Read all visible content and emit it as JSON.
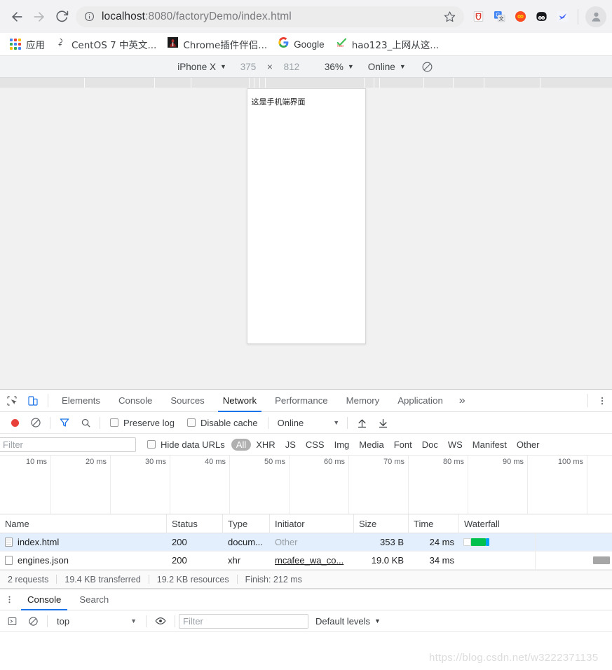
{
  "browser": {
    "nav": {
      "back": "back-arrow",
      "forward": "forward-arrow",
      "reload": "reload"
    },
    "omnibox": {
      "info_icon": "info-circle-icon",
      "url_host": "localhost",
      "url_rest": ":8080/factoryDemo/index.html",
      "star_icon": "bookmark-star-icon"
    },
    "extensions": [
      {
        "name": "maxthon-shield-extension",
        "glyph": "shield"
      },
      {
        "name": "google-translate-extension",
        "glyph": "translate"
      },
      {
        "name": "infinity-newtab-extension",
        "glyph": "infinity"
      },
      {
        "name": "panda-extension",
        "glyph": "panda"
      },
      {
        "name": "blue-bird-extension",
        "glyph": "bird"
      }
    ],
    "profile": "profile-avatar"
  },
  "bookmarks": {
    "apps_label": "应用",
    "items": [
      {
        "label": "CentOS 7 中英文...",
        "icon": "centos-icon"
      },
      {
        "label": "Chrome插件伴侣...",
        "icon": "chrome-companion-icon"
      },
      {
        "label": "Google",
        "icon": "google-icon"
      },
      {
        "label": "hao123_上网从这...",
        "icon": "hao123-icon"
      }
    ]
  },
  "device_toolbar": {
    "device": "iPhone X",
    "width": "375",
    "times": "×",
    "height": "812",
    "zoom": "36%",
    "throttle": "Online",
    "rotate_icon": "rotate-device-icon"
  },
  "viewport": {
    "page_text": "这是手机端界面"
  },
  "devtools": {
    "inspect_icon": "inspect-element-icon",
    "device_toggle_icon": "toggle-device-toolbar-icon",
    "tabs": [
      {
        "label": "Elements",
        "active": false
      },
      {
        "label": "Console",
        "active": false
      },
      {
        "label": "Sources",
        "active": false
      },
      {
        "label": "Network",
        "active": true
      },
      {
        "label": "Performance",
        "active": false
      },
      {
        "label": "Memory",
        "active": false
      },
      {
        "label": "Application",
        "active": false
      }
    ],
    "more_tabs": "»",
    "menu_icon": "kebab-menu-icon"
  },
  "network_toolbar": {
    "record_icon": "record-button",
    "clear_icon": "clear-button",
    "filter_icon": "filter-funnel-icon",
    "search_icon": "search-icon",
    "preserve_log": "Preserve log",
    "disable_cache": "Disable cache",
    "throttle_value": "Online",
    "import_icon": "import-har-icon",
    "export_icon": "export-har-icon"
  },
  "filter_row": {
    "filter_placeholder": "Filter",
    "hide_data_urls": "Hide data URLs",
    "types": [
      {
        "label": "All",
        "active": true
      },
      {
        "label": "XHR",
        "active": false
      },
      {
        "label": "JS",
        "active": false
      },
      {
        "label": "CSS",
        "active": false
      },
      {
        "label": "Img",
        "active": false
      },
      {
        "label": "Media",
        "active": false
      },
      {
        "label": "Font",
        "active": false
      },
      {
        "label": "Doc",
        "active": false
      },
      {
        "label": "WS",
        "active": false
      },
      {
        "label": "Manifest",
        "active": false
      },
      {
        "label": "Other",
        "active": false
      }
    ]
  },
  "overview": {
    "ticks": [
      "10 ms",
      "20 ms",
      "30 ms",
      "40 ms",
      "50 ms",
      "60 ms",
      "70 ms",
      "80 ms",
      "90 ms",
      "100 ms"
    ]
  },
  "requests_table": {
    "columns": [
      "Name",
      "Status",
      "Type",
      "Initiator",
      "Size",
      "Time",
      "Waterfall"
    ],
    "rows": [
      {
        "name": "index.html",
        "status": "200",
        "type": "docum...",
        "initiator": "Other",
        "initiator_style": "muted",
        "size": "353 B",
        "time": "24 ms",
        "selected": true,
        "waterfall": {
          "start_pct": 2,
          "wait_pct": 4,
          "bar_pct": 10,
          "color": "#00c14d",
          "end_color": "#00a2f3"
        }
      },
      {
        "name": "engines.json",
        "status": "200",
        "type": "xhr",
        "initiator": "mcafee_wa_co...",
        "initiator_style": "link",
        "size": "19.0 KB",
        "time": "34 ms",
        "selected": false,
        "waterfall": {
          "start_pct": 92,
          "wait_pct": 0,
          "bar_pct": 8,
          "color": "#a6a6a6",
          "end_color": "#a6a6a6"
        }
      }
    ]
  },
  "summary": {
    "requests": "2 requests",
    "transferred": "19.4 KB transferred",
    "resources": "19.2 KB resources",
    "finish": "Finish: 212 ms"
  },
  "drawer": {
    "menu_icon": "kebab-menu-icon",
    "tabs": [
      {
        "label": "Console",
        "active": true
      },
      {
        "label": "Search",
        "active": false
      }
    ],
    "execute_icon": "execution-context-icon",
    "clear_icon": "clear-console-icon",
    "context": "top",
    "eye_icon": "live-expression-icon",
    "filter_placeholder": "Filter",
    "levels": "Default levels"
  },
  "watermark": "https://blog.csdn.net/w3222371135",
  "colors": {
    "accent": "#1a73e8",
    "record_red": "#e8413a",
    "waterfall_green": "#00c14d",
    "selection_blue": "#e3effc"
  }
}
